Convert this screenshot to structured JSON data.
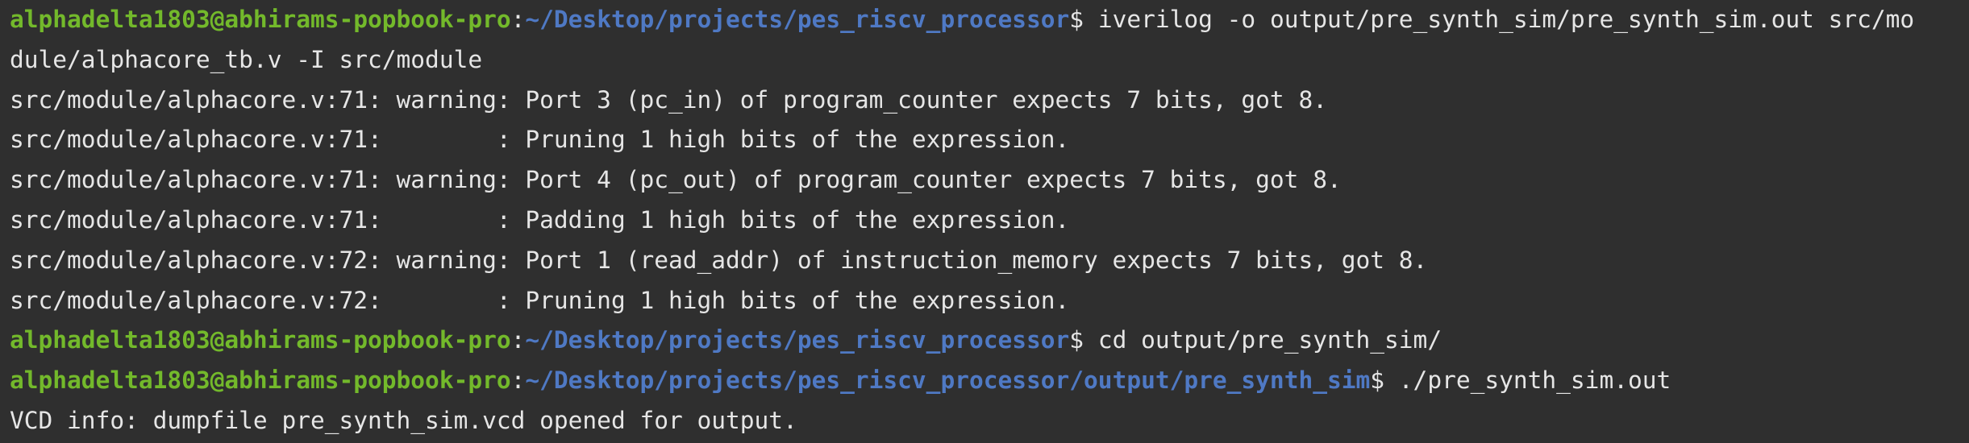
{
  "colors": {
    "background": "#2f2f2f",
    "text": "#e6e6e6",
    "user_host": "#73b92b",
    "path": "#4f79c4"
  },
  "terminal": {
    "lines": [
      {
        "type": "prompt",
        "user_host": "alphadelta1803@abhirams-popbook-pro",
        "sep": ":",
        "path": "~/Desktop/projects/pes_riscv_processor",
        "symbol": "$",
        "command": " iverilog -o output/pre_synth_sim/pre_synth_sim.out src/mo"
      },
      {
        "type": "output",
        "text": "dule/alphacore_tb.v -I src/module"
      },
      {
        "type": "output",
        "text": "src/module/alphacore.v:71: warning: Port 3 (pc_in) of program_counter expects 7 bits, got 8."
      },
      {
        "type": "output",
        "text": "src/module/alphacore.v:71:        : Pruning 1 high bits of the expression."
      },
      {
        "type": "output",
        "text": "src/module/alphacore.v:71: warning: Port 4 (pc_out) of program_counter expects 7 bits, got 8."
      },
      {
        "type": "output",
        "text": "src/module/alphacore.v:71:        : Padding 1 high bits of the expression."
      },
      {
        "type": "output",
        "text": "src/module/alphacore.v:72: warning: Port 1 (read_addr) of instruction_memory expects 7 bits, got 8."
      },
      {
        "type": "output",
        "text": "src/module/alphacore.v:72:        : Pruning 1 high bits of the expression."
      },
      {
        "type": "prompt",
        "user_host": "alphadelta1803@abhirams-popbook-pro",
        "sep": ":",
        "path": "~/Desktop/projects/pes_riscv_processor",
        "symbol": "$",
        "command": " cd output/pre_synth_sim/"
      },
      {
        "type": "prompt",
        "user_host": "alphadelta1803@abhirams-popbook-pro",
        "sep": ":",
        "path": "~/Desktop/projects/pes_riscv_processor/output/pre_synth_sim",
        "symbol": "$",
        "command": " ./pre_synth_sim.out"
      },
      {
        "type": "output",
        "text": "VCD info: dumpfile pre_synth_sim.vcd opened for output."
      }
    ]
  }
}
